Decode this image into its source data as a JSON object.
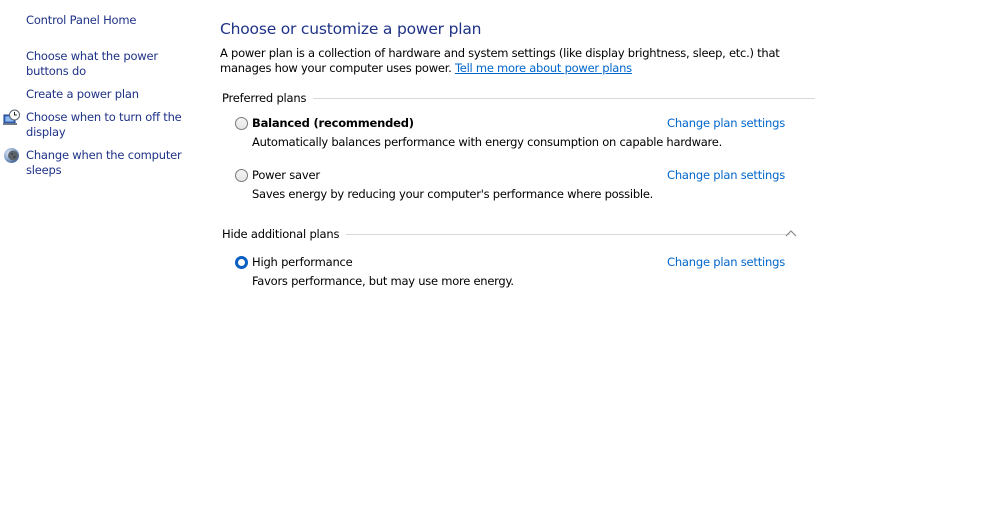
{
  "sidebar": {
    "home_label": "Control Panel Home",
    "links": [
      {
        "label": "Choose what the power buttons do",
        "icon": null
      },
      {
        "label": "Create a power plan",
        "icon": null
      },
      {
        "label": "Choose when to turn off the display",
        "icon": "display-clock-icon"
      },
      {
        "label": "Change when the computer sleeps",
        "icon": "moon-sleep-icon"
      }
    ]
  },
  "main": {
    "title": "Choose or customize a power plan",
    "description": "A power plan is a collection of hardware and system settings (like display brightness, sleep, etc.) that manages how your computer uses power.",
    "learn_more_link": "Tell me more about power plans",
    "preferred_group": {
      "label": "Preferred plans",
      "plans": [
        {
          "name": "Balanced (recommended)",
          "description": "Automatically balances performance with energy consumption on capable hardware.",
          "selected": false,
          "bold": true,
          "link": "Change plan settings"
        },
        {
          "name": "Power saver",
          "description": "Saves energy by reducing your computer's performance where possible.",
          "selected": false,
          "bold": false,
          "link": "Change plan settings"
        }
      ]
    },
    "additional_group": {
      "label": "Hide additional plans",
      "toggle_icon": "chevron-up-icon",
      "plans": [
        {
          "name": "High performance",
          "description": "Favors performance, but may use more energy.",
          "selected": true,
          "bold": false,
          "link": "Change plan settings"
        }
      ]
    }
  },
  "colors": {
    "heading": "#1e3287",
    "link": "#0066cc",
    "radio_selected": "#0a60c2",
    "divider": "#d9d9d9"
  }
}
